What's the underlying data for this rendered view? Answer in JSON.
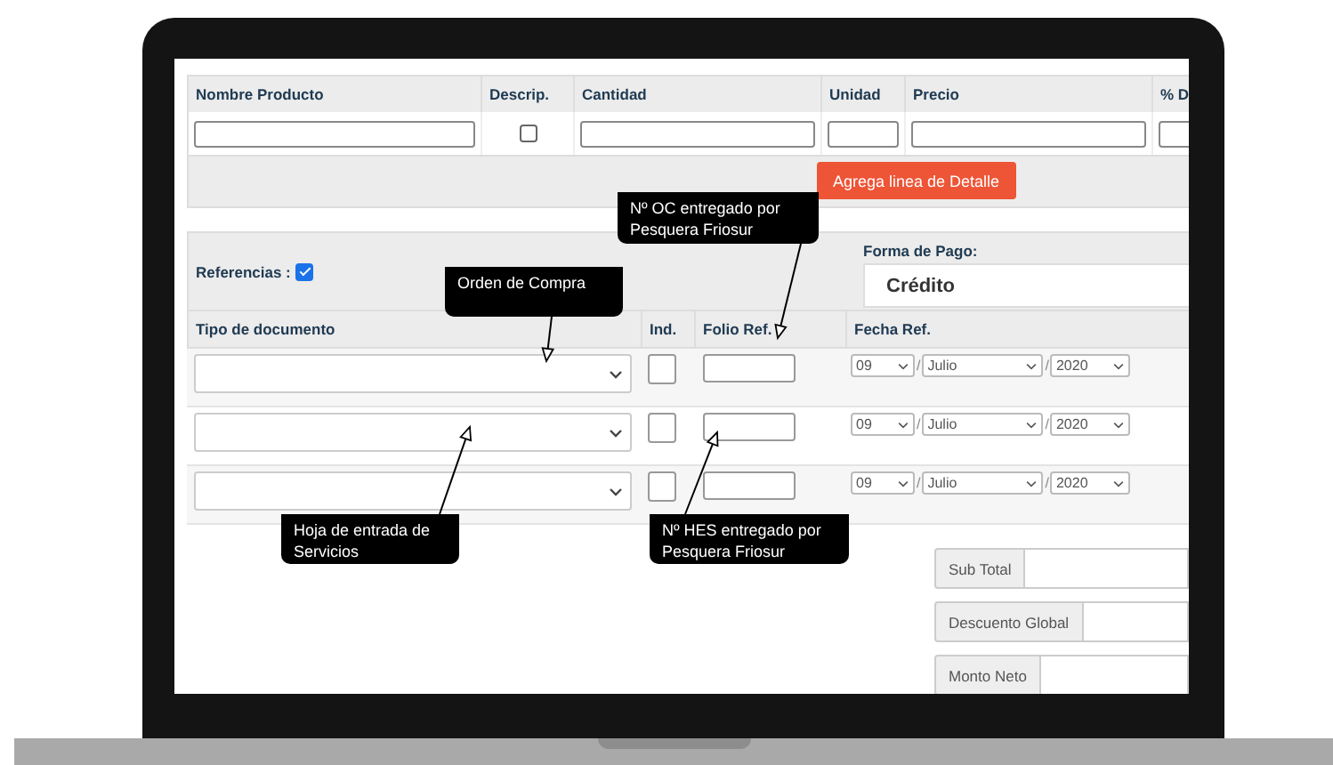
{
  "product_table": {
    "columns": [
      "Nombre Producto",
      "Descrip.",
      "Cantidad",
      "Unidad",
      "Precio",
      "% D"
    ],
    "row": {
      "descrip_checked": false
    },
    "add_button": "Agrega linea de Detalle"
  },
  "references": {
    "label": "Referencias :",
    "checked": true,
    "payment": {
      "label": "Forma de Pago:",
      "value": "Crédito"
    },
    "columns": [
      "Tipo de documento",
      "Ind.",
      "Folio Ref.",
      "Fecha Ref."
    ],
    "rows": [
      {
        "ind_checked": false,
        "day": "09",
        "month": "Julio",
        "year": "2020",
        "separator": "/"
      },
      {
        "ind_checked": false,
        "day": "09",
        "month": "Julio",
        "year": "2020",
        "separator": "/"
      },
      {
        "ind_checked": false,
        "day": "09",
        "month": "Julio",
        "year": "2020",
        "separator": "/"
      }
    ]
  },
  "totals": [
    {
      "label": "Sub Total"
    },
    {
      "label": "Descuento Global"
    },
    {
      "label": "Monto Neto"
    }
  ],
  "callouts": [
    {
      "text": "Orden de Compra"
    },
    {
      "text": "Nº OC entregado por Pesquera Friosur"
    },
    {
      "text": "Hoja de entrada de Servicios"
    },
    {
      "text": "Nº HES entregado por Pesquera Friosur"
    }
  ]
}
